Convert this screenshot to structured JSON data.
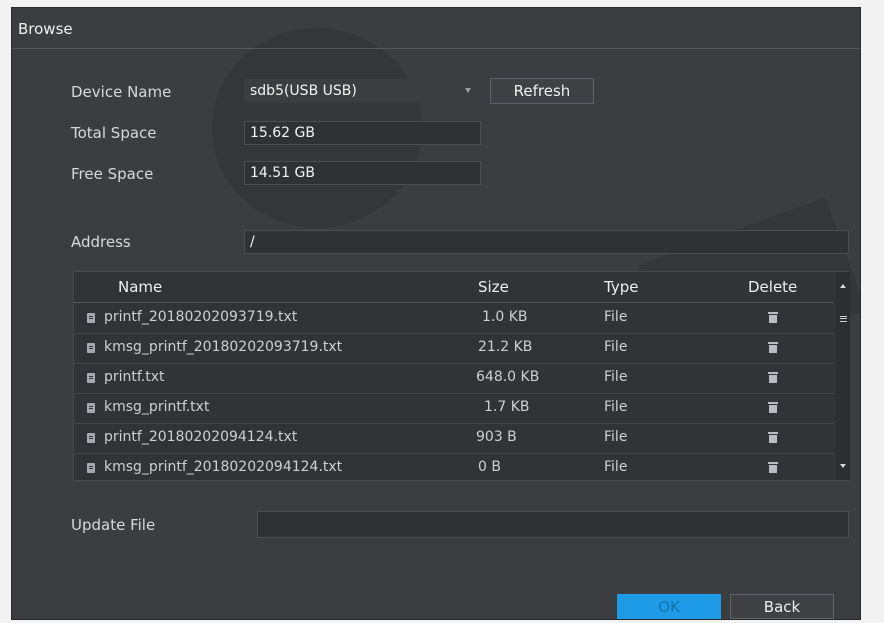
{
  "dialog": {
    "title": "Browse"
  },
  "device": {
    "name_label": "Device Name",
    "name_value": "sdb5(USB USB)",
    "refresh_label": "Refresh",
    "total_label": "Total Space",
    "total_value": "15.62 GB",
    "free_label": "Free Space",
    "free_value": "14.51 GB"
  },
  "address": {
    "label": "Address",
    "value": "/"
  },
  "table": {
    "headers": {
      "name": "Name",
      "size": "Size",
      "type": "Type",
      "delete": "Delete"
    },
    "rows": [
      {
        "name": "printf_20180202093719.txt",
        "size": "1.0 KB",
        "type": "File"
      },
      {
        "name": "kmsg_printf_20180202093719.txt",
        "size": "21.2 KB",
        "type": "File"
      },
      {
        "name": "printf.txt",
        "size": "648.0 KB",
        "type": "File"
      },
      {
        "name": "kmsg_printf.txt",
        "size": "1.7 KB",
        "type": "File"
      },
      {
        "name": "printf_20180202094124.txt",
        "size": "903 B",
        "type": "File"
      },
      {
        "name": "kmsg_printf_20180202094124.txt",
        "size": "0 B",
        "type": "File"
      }
    ],
    "row_icon": "file-icon",
    "delete_icon": "trash-icon"
  },
  "update": {
    "label": "Update File",
    "value": ""
  },
  "footer": {
    "ok_label": "OK",
    "back_label": "Back"
  },
  "colors": {
    "accent": "#1e9be6",
    "panel": "#3b3d40"
  }
}
